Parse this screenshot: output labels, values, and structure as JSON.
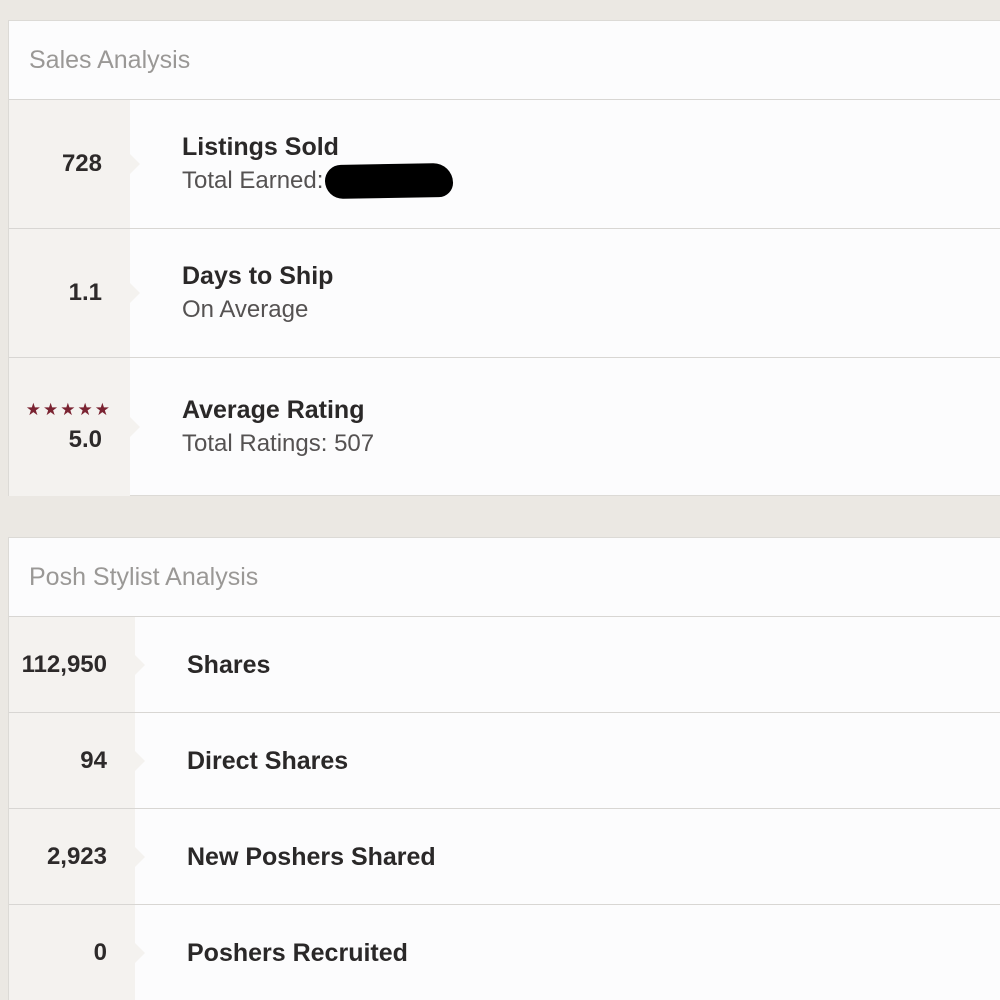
{
  "sales_analysis": {
    "header": "Sales Analysis",
    "rows": [
      {
        "value": "728",
        "title": "Listings Sold",
        "subtitle_label": "Total Earned:"
      },
      {
        "value": "1.1",
        "title": "Days to Ship",
        "subtitle": "On Average"
      },
      {
        "value": "5.0",
        "title": "Average Rating",
        "subtitle": "Total Ratings: 507",
        "stars": 5
      }
    ]
  },
  "posh_stylist_analysis": {
    "header": "Posh Stylist Analysis",
    "rows": [
      {
        "value": "112,950",
        "title": "Shares"
      },
      {
        "value": "94",
        "title": "Direct Shares"
      },
      {
        "value": "2,923",
        "title": "New Poshers Shared"
      },
      {
        "value": "0",
        "title": "Poshers Recruited"
      }
    ]
  },
  "colors": {
    "star": "#7a2331",
    "link_accent": "#4aa3c8"
  }
}
